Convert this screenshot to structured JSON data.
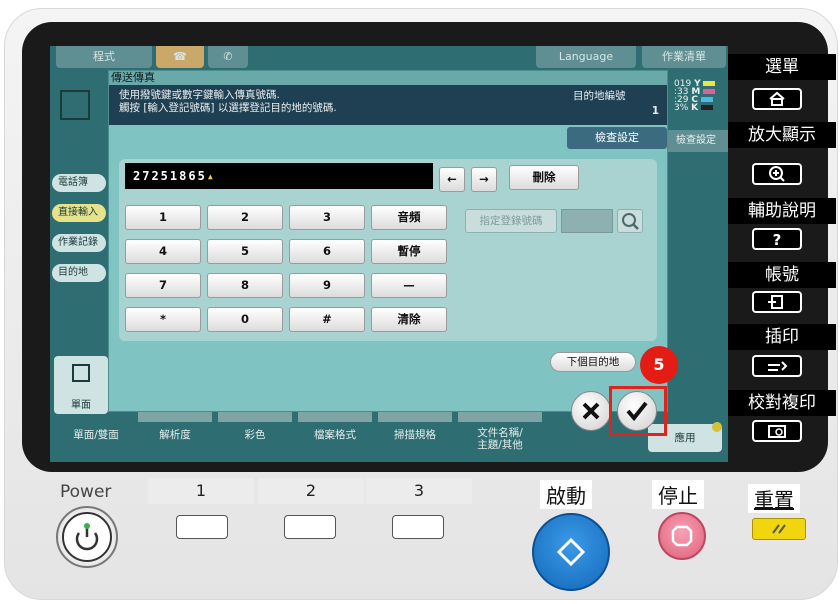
{
  "screen": {
    "top_tabs": [
      "程式",
      "Language",
      "作業清單"
    ],
    "side_buttons": [
      "電話簿",
      "直接輸入",
      "作業記錄",
      "目的地"
    ],
    "side_right": "檢查設定",
    "bottom_labels": [
      "單面/雙面",
      "解析度",
      "彩色",
      "檔案格式",
      "掃描規格",
      "文件名稱/\n主題/其他"
    ],
    "bottom_left_label": "單面",
    "apply_label": "應用",
    "toner_levels": [
      {
        "code": "Y",
        "value": "019",
        "color": "#f0e24a"
      },
      {
        "code": "M",
        "value": ":33",
        "color": "#e0609a"
      },
      {
        "code": "C",
        "value": ":29",
        "color": "#50b6e6"
      },
      {
        "code": "K",
        "value": "3%",
        "color": "#222222"
      }
    ]
  },
  "dialog": {
    "title": "傳送傳真",
    "instruction_line1": "使用撥號鍵或數字鍵輸入傳真號碼.",
    "instruction_line2": "觸按 [輸入登記號碼] 以選擇登記目的地的號碼.",
    "dest_label": "目的地編號",
    "dest_value": "1",
    "check_settings": "檢查設定",
    "fax_number": "27251865",
    "left_arrow": "←",
    "right_arrow": "→",
    "delete_label": "刪除",
    "keys": [
      [
        "1",
        "2",
        "3",
        "音頻"
      ],
      [
        "4",
        "5",
        "6",
        "暫停"
      ],
      [
        "7",
        "8",
        "9",
        "—"
      ],
      [
        "*",
        "0",
        "#",
        "清除"
      ]
    ],
    "register_number_label": "指定登錄號碼",
    "next_destination_label": "下個目的地",
    "step_number": "5"
  },
  "right_panel": {
    "menu": "選單",
    "zoom": "放大顯示",
    "help": "輔助說明",
    "account": "帳號",
    "interrupt": "插印",
    "proof_copy": "校對複印"
  },
  "physical": {
    "power_label": "Power",
    "number_tabs": [
      "1",
      "2",
      "3"
    ],
    "start_label": "啟動",
    "stop_label": "停止",
    "reset_label": "重置"
  }
}
